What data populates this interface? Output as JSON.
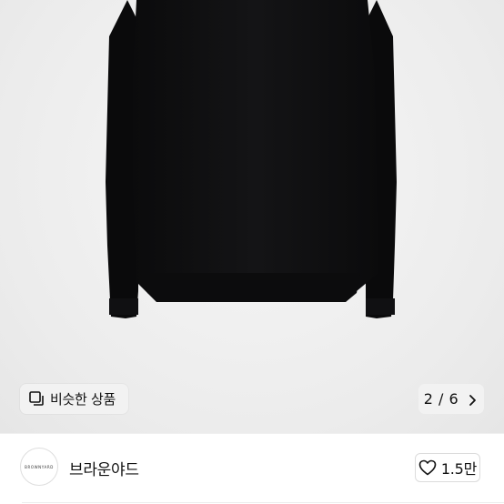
{
  "product": {
    "image_icon": "product-photo-black-longsleeve"
  },
  "gallery": {
    "similar_label": "비슷한 상품",
    "similar_icon": "copy-squares-icon",
    "counter": "2 / 6",
    "chevron_icon": "chevron-right-icon"
  },
  "shop": {
    "avatar_text": "BROWNYARD",
    "name": "브라운야드",
    "like_icon": "heart-outline-icon",
    "like_count": "1.5만"
  }
}
